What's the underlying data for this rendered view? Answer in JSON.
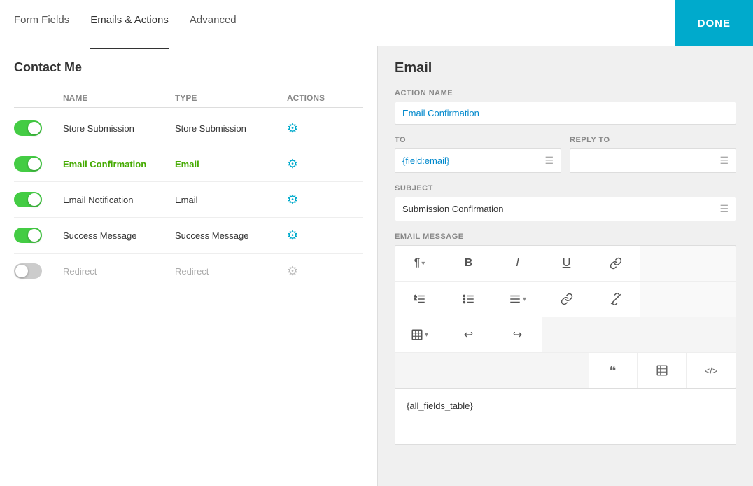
{
  "header": {
    "tabs": [
      {
        "id": "form-fields",
        "label": "Form Fields",
        "active": false
      },
      {
        "id": "emails-actions",
        "label": "Emails & Actions",
        "active": true
      },
      {
        "id": "advanced",
        "label": "Advanced",
        "active": false
      }
    ],
    "done_label": "DONE"
  },
  "left": {
    "section_title": "Contact Me",
    "table_headers": [
      "",
      "NAME",
      "TYPE",
      "ACTIONS"
    ],
    "rows": [
      {
        "id": "store-submission",
        "toggle": "on",
        "name": "Store Submission",
        "type": "Store Submission",
        "active": false
      },
      {
        "id": "email-confirmation",
        "toggle": "on",
        "name": "Email Confirmation",
        "type": "Email",
        "active": true
      },
      {
        "id": "email-notification",
        "toggle": "on",
        "name": "Email Notification",
        "type": "Email",
        "active": false
      },
      {
        "id": "success-message",
        "toggle": "on",
        "name": "Success Message",
        "type": "Success Message",
        "active": false
      },
      {
        "id": "redirect",
        "toggle": "off",
        "name": "Redirect",
        "type": "Redirect",
        "active": false
      }
    ]
  },
  "right": {
    "title": "Email",
    "action_name_label": "ACTION NAME",
    "action_name_value": "Email Confirmation",
    "to_label": "TO",
    "to_value": "{field:email}",
    "reply_to_label": "REPLY TO",
    "reply_to_value": "",
    "subject_label": "SUBJECT",
    "subject_value": "Submission Confirmation",
    "email_message_label": "EMAIL MESSAGE",
    "toolbar_rows": [
      [
        "¶ ▾",
        "B",
        "I",
        "U",
        "🔗"
      ],
      [
        "☰",
        "≡",
        "≡ ▾",
        "🔗",
        "✂"
      ],
      [
        "▦ ▾",
        "↩",
        "↪"
      ]
    ],
    "bottom_toolbar": [
      "❝",
      "▦",
      "<>"
    ],
    "editor_content": "{all_fields_table}"
  }
}
